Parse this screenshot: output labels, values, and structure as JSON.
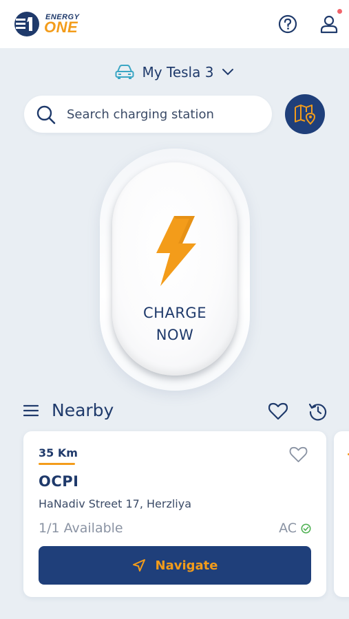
{
  "header": {
    "logo_word1": "ENERGY",
    "logo_word2": "ONE",
    "icons": [
      "help-icon",
      "user-icon"
    ],
    "has_notification": true
  },
  "vehicle": {
    "name": "My Tesla 3",
    "icon": "car-icon"
  },
  "search": {
    "placeholder": "Search charging station",
    "value": ""
  },
  "charge": {
    "line1": "CHARGE",
    "line2": "NOW",
    "icon": "lightning-bolt-icon"
  },
  "nearby": {
    "title": "Nearby"
  },
  "stations": [
    {
      "distance": "35 Km",
      "name": "OCPI",
      "address": "HaNadiv Street 17, Herzliya",
      "availability": "1/1 Available",
      "connector": "AC",
      "navigate_label": "Navigate"
    }
  ],
  "colors": {
    "brand_navy": "#1f3f7a",
    "brand_orange": "#f39c1a",
    "background": "#e9eef3",
    "available_green": "#4cb050",
    "notification_red": "#f0646b"
  }
}
